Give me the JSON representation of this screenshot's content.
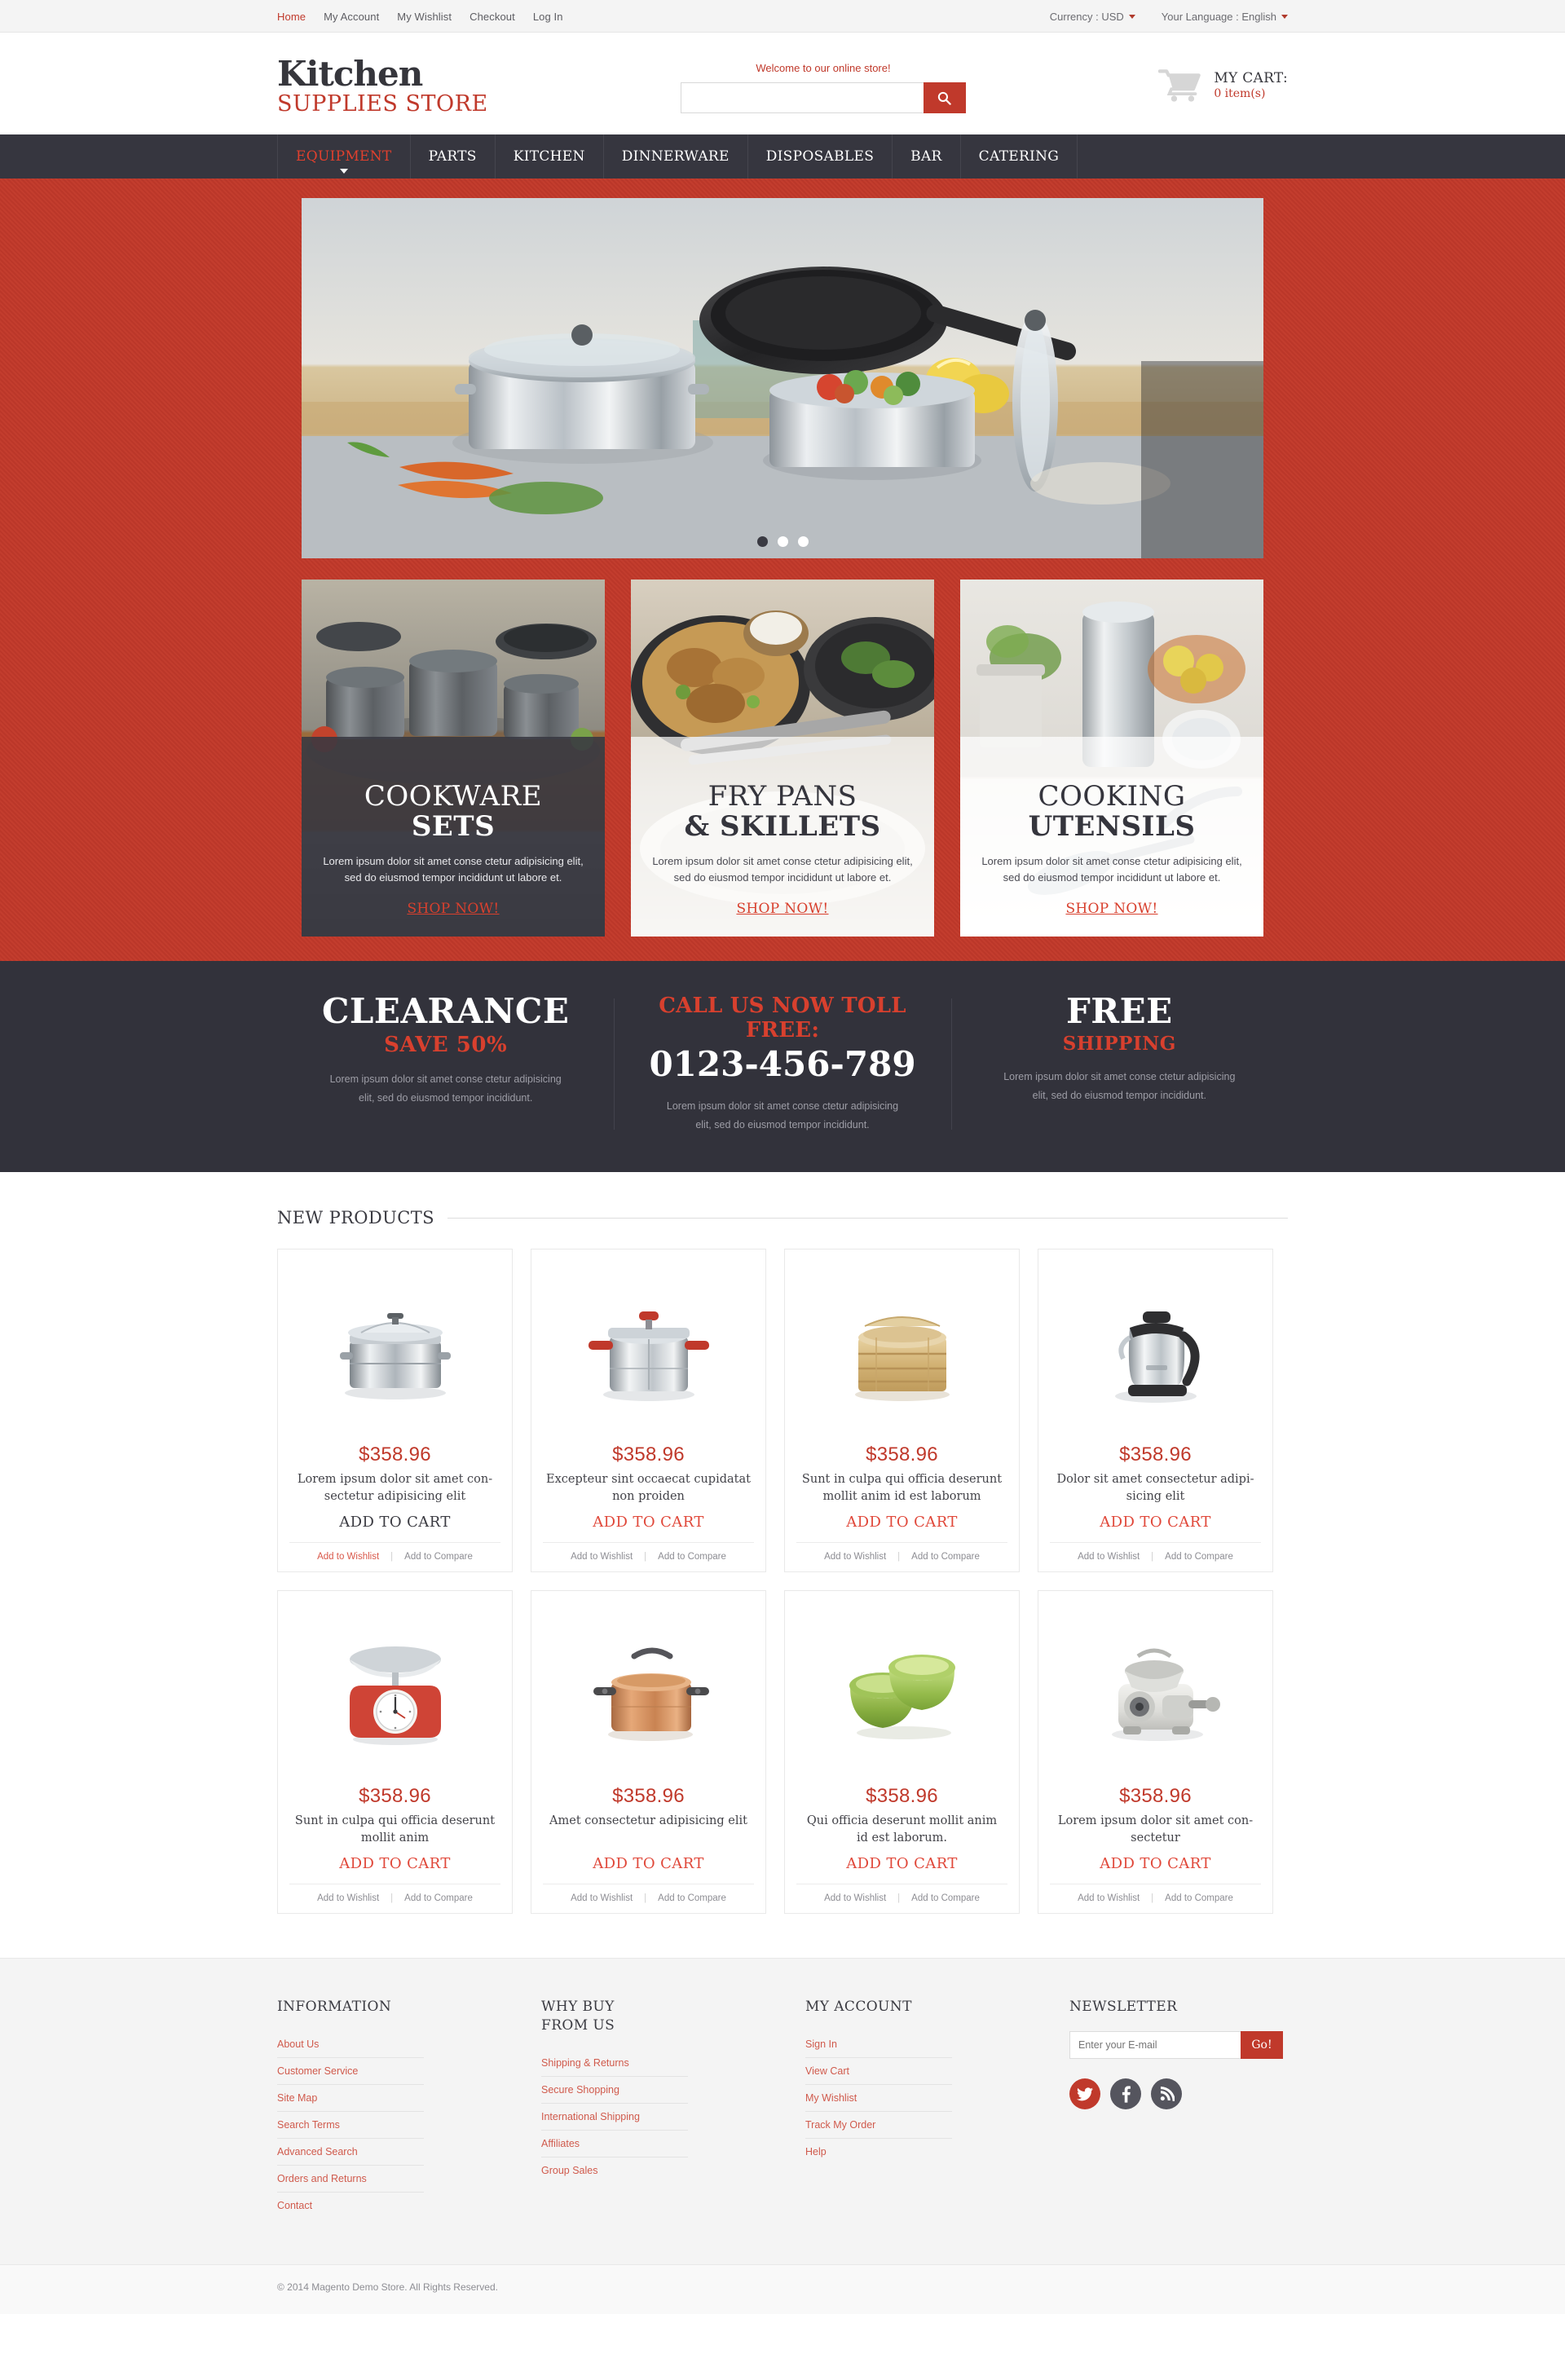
{
  "topbar": {
    "links": [
      {
        "label": "Home",
        "active": true
      },
      {
        "label": "My Account",
        "active": false
      },
      {
        "label": "My Wishlist",
        "active": false
      },
      {
        "label": "Checkout",
        "active": false
      },
      {
        "label": "Log In",
        "active": false
      }
    ],
    "currency_label": "Currency : USD",
    "language_label": "Your Language : English"
  },
  "header": {
    "logo_top": "Kitchen",
    "logo_bottom": "SUPPLIES STORE",
    "welcome": "Welcome to our online store!",
    "search_placeholder": "",
    "search_value": "",
    "search_icon": "search-icon",
    "cart_title": "MY CART:",
    "cart_count": "0 item(s)"
  },
  "nav": {
    "items": [
      {
        "label": "EQUIPMENT",
        "active": true,
        "has_dropdown": true
      },
      {
        "label": "PARTS",
        "active": false,
        "has_dropdown": false
      },
      {
        "label": "KITCHEN",
        "active": false,
        "has_dropdown": false
      },
      {
        "label": "DINNERWARE",
        "active": false,
        "has_dropdown": false
      },
      {
        "label": "DISPOSABLES",
        "active": false,
        "has_dropdown": false
      },
      {
        "label": "BAR",
        "active": false,
        "has_dropdown": false
      },
      {
        "label": "CATERING",
        "active": false,
        "has_dropdown": false
      }
    ]
  },
  "slider": {
    "dots": [
      {
        "active": true
      },
      {
        "active": false
      },
      {
        "active": false
      }
    ]
  },
  "categories": [
    {
      "title_line1": "COOKWARE",
      "title_line2": "SETS",
      "desc": "Lorem ipsum dolor sit amet conse ctetur adipisicing elit, sed do eiusmod tempor incididunt ut labore et.",
      "link": "SHOP NOW!",
      "style": "dark"
    },
    {
      "title_line1": "FRY PANS",
      "title_line2": "& SKILLETS",
      "desc": "Lorem ipsum dolor sit amet conse ctetur adipisicing elit, sed do eiusmod tempor incididunt ut labore et.",
      "link": "SHOP NOW!",
      "style": "light"
    },
    {
      "title_line1": "COOKING",
      "title_line2": "UTENSILS",
      "desc": "Lorem ipsum dolor sit amet conse ctetur adipisicing elit, sed do eiusmod tempor incididunt ut labore et.",
      "link": "SHOP NOW!",
      "style": "light"
    }
  ],
  "promo": {
    "col1_h1": "CLEARANCE",
    "col1_h2": "SAVE 50%",
    "col1_desc": "Lorem ipsum dolor sit amet conse ctetur adipisicing elit, sed do eiusmod tempor incididunt.",
    "col2_label": "CALL US NOW TOLL FREE:",
    "col2_phone": "0123-456-789",
    "col2_desc": "Lorem ipsum dolor sit amet conse ctetur adipisicing elit, sed do eiusmod tempor incididunt.",
    "col3_h1": "FREE",
    "col3_h2": "SHIPPING",
    "col3_desc": "Lorem ipsum dolor sit amet conse ctetur adipisicing elit, sed do eiusmod tempor incididunt."
  },
  "new_products": {
    "section_title": "NEW PRODUCTS",
    "add_to_cart_label": "ADD TO CART",
    "wishlist_label": "Add to Wishlist",
    "compare_label": "Add to Compare",
    "separator": "|",
    "items": [
      {
        "price": "$358.96",
        "name": "Lorem ipsum dolor sit amet con-sectetur adipisicing elit",
        "image": "steamer-pot",
        "cart_hover": true,
        "wishlist_hover": true
      },
      {
        "price": "$358.96",
        "name": "Excepteur sint occaecat cupidatat non proiden",
        "image": "pressure-cooker",
        "cart_hover": false,
        "wishlist_hover": false
      },
      {
        "price": "$358.96",
        "name": "Sunt in culpa qui officia deserunt mollit anim id est laborum",
        "image": "bamboo-steamer",
        "cart_hover": false,
        "wishlist_hover": false
      },
      {
        "price": "$358.96",
        "name": "Dolor sit amet consectetur adipi-sicing elit",
        "image": "electric-kettle",
        "cart_hover": false,
        "wishlist_hover": false
      },
      {
        "price": "$358.96",
        "name": "Sunt in culpa qui officia deserunt mollit anim",
        "image": "kitchen-scale",
        "cart_hover": false,
        "wishlist_hover": false
      },
      {
        "price": "$358.96",
        "name": "Amet consectetur adipisicing elit",
        "image": "copper-saucepan",
        "cart_hover": false,
        "wishlist_hover": false
      },
      {
        "price": "$358.96",
        "name": "Qui officia deserunt mollit anim id est laborum.",
        "image": "green-bowls",
        "cart_hover": false,
        "wishlist_hover": false
      },
      {
        "price": "$358.96",
        "name": "Lorem ipsum dolor sit amet con-sectetur",
        "image": "meat-grinder",
        "cart_hover": false,
        "wishlist_hover": false
      }
    ]
  },
  "footer": {
    "col1_title": "INFORMATION",
    "col1_links": [
      "About Us",
      "Customer Service",
      "Site Map",
      "Search Terms",
      "Advanced Search",
      "Orders and Returns",
      "Contact"
    ],
    "col2_title": "WHY BUY\nFROM US",
    "col2_links": [
      "Shipping & Returns",
      "Secure Shopping",
      "International Shipping",
      "Affiliates",
      "Group Sales"
    ],
    "col3_title": "MY ACCOUNT",
    "col3_links": [
      "Sign In",
      "View Cart",
      "My Wishlist",
      "Track My Order",
      "Help"
    ],
    "col4_title": "NEWSLETTER",
    "newsletter_placeholder": "Enter your E-mail",
    "newsletter_value": "",
    "newsletter_button": "Go!",
    "socials": [
      {
        "name": "twitter-icon",
        "style": "tw"
      },
      {
        "name": "facebook-icon",
        "style": "fb"
      },
      {
        "name": "rss-icon",
        "style": "rss"
      }
    ]
  },
  "copyright": {
    "text": "© 2014 Magento Demo Store. All Rights Reserved."
  },
  "colors": {
    "brand_red": "#c0392b",
    "dark": "#36363f",
    "light_bg": "#f4f4f4"
  }
}
